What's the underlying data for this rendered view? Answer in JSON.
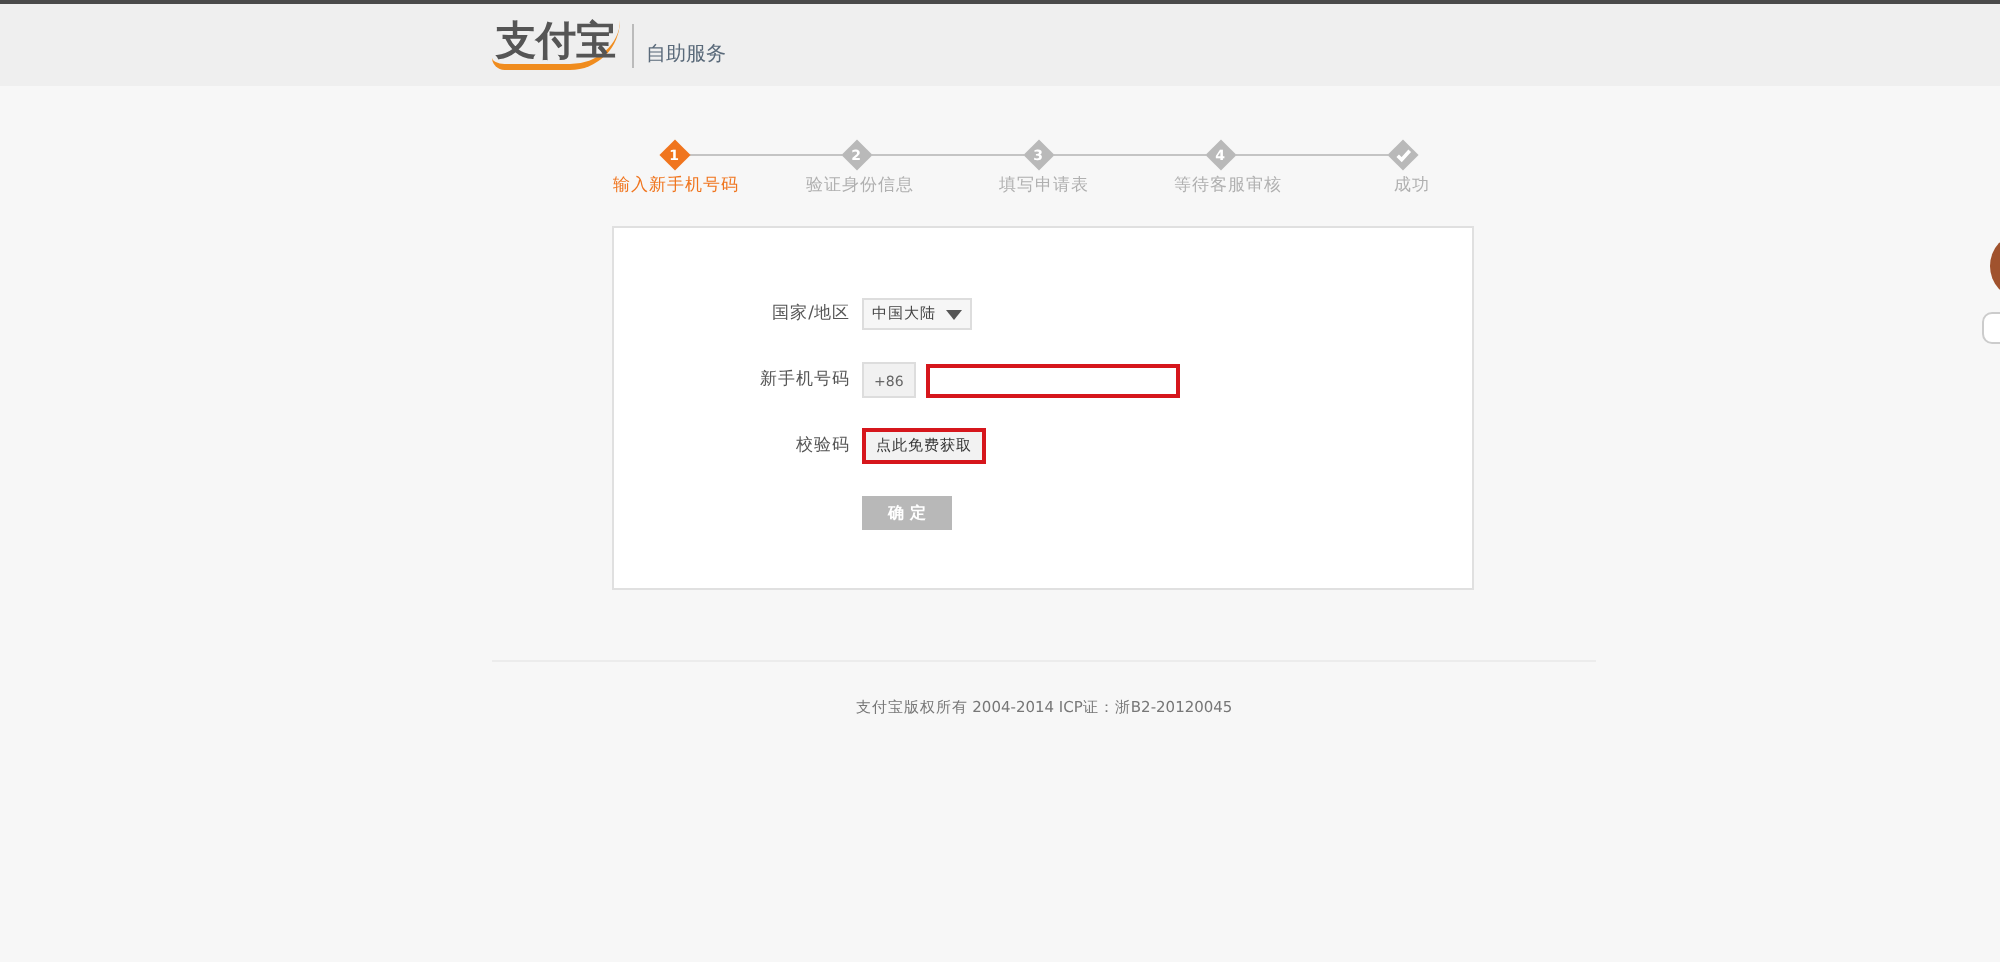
{
  "header": {
    "logo": "支付宝",
    "service_title": "自助服务"
  },
  "steps": [
    {
      "kind": "number",
      "number": "1",
      "label": "输入新手机号码",
      "selected": true
    },
    {
      "kind": "number",
      "number": "2",
      "label": "验证身份信息",
      "selected": false
    },
    {
      "kind": "number",
      "number": "3",
      "label": "填写申请表",
      "selected": false
    },
    {
      "kind": "number",
      "number": "4",
      "label": "等待客服审核",
      "selected": false
    },
    {
      "kind": "check",
      "label": "成功",
      "selected": false
    }
  ],
  "form": {
    "country_label": "国家/地区",
    "country_value": "中国大陆",
    "phone_label": "新手机号码",
    "phone_prefix": "+86",
    "code_label": "校验码",
    "code_button": "点此免费获取",
    "submit_button": "确 定",
    "submit_disabled": true
  },
  "footer": {
    "copyright": "支付宝版权所有 2004-2014 ICP证：浙B2-20120045"
  }
}
